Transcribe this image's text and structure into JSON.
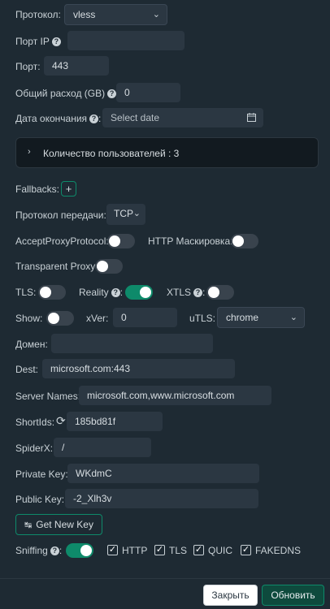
{
  "form": {
    "protocol": {
      "label": "Протокол:",
      "value": "vless"
    },
    "port_ip": {
      "label": "Порт IP",
      "value": ""
    },
    "port": {
      "label": "Порт:",
      "value": "443"
    },
    "total": {
      "label": "Общий расход (GB)",
      "value": "0"
    },
    "expiry": {
      "label": "Дата окончания",
      "placeholder": "Select date"
    },
    "clients": {
      "label": "Количество пользователей : 3"
    },
    "fallbacks": {
      "label": "Fallbacks:",
      "add": "+"
    },
    "transport": {
      "label": "Протокол передачи:",
      "value": "TCP"
    },
    "accept_proxy": {
      "label": "AcceptProxyProtocol:",
      "on": false
    },
    "http_mask": {
      "label": "HTTP Маскировка:",
      "on": false
    },
    "transparent_proxy": {
      "label": "Transparent Proxy:",
      "on": false
    },
    "tls": {
      "label": "TLS:",
      "on": false
    },
    "reality": {
      "label": "Reality",
      "on": true
    },
    "xtls": {
      "label": "XTLS",
      "on": false
    },
    "show": {
      "label": "Show:",
      "on": false
    },
    "xver": {
      "label": "xVer:",
      "value": "0"
    },
    "utls": {
      "label": "uTLS:",
      "value": "chrome"
    },
    "domain": {
      "label": "Домен:",
      "value": ""
    },
    "dest": {
      "label": "Dest:",
      "value": "microsoft.com:443"
    },
    "server_names": {
      "label": "Server Names:",
      "value": "microsoft.com,www.microsoft.com"
    },
    "short_ids": {
      "label": "ShortIds:",
      "value": "185bd81f"
    },
    "spider_x": {
      "label": "SpiderX:",
      "value": "/"
    },
    "private_key": {
      "label": "Private Key:",
      "value": "WKdmC"
    },
    "public_key": {
      "label": "Public Key:",
      "value": "-2_Xlh3v"
    },
    "get_new_key": "Get New Key",
    "sniffing": {
      "label": "Sniffing",
      "on": true,
      "options": [
        "HTTP",
        "TLS",
        "QUIC",
        "FAKEDNS"
      ]
    }
  },
  "footer": {
    "close": "Закрыть",
    "update": "Обновить"
  },
  "colors": {
    "background": "#1e2a33",
    "accent": "#0e8a6a",
    "input": "#2b3742"
  }
}
